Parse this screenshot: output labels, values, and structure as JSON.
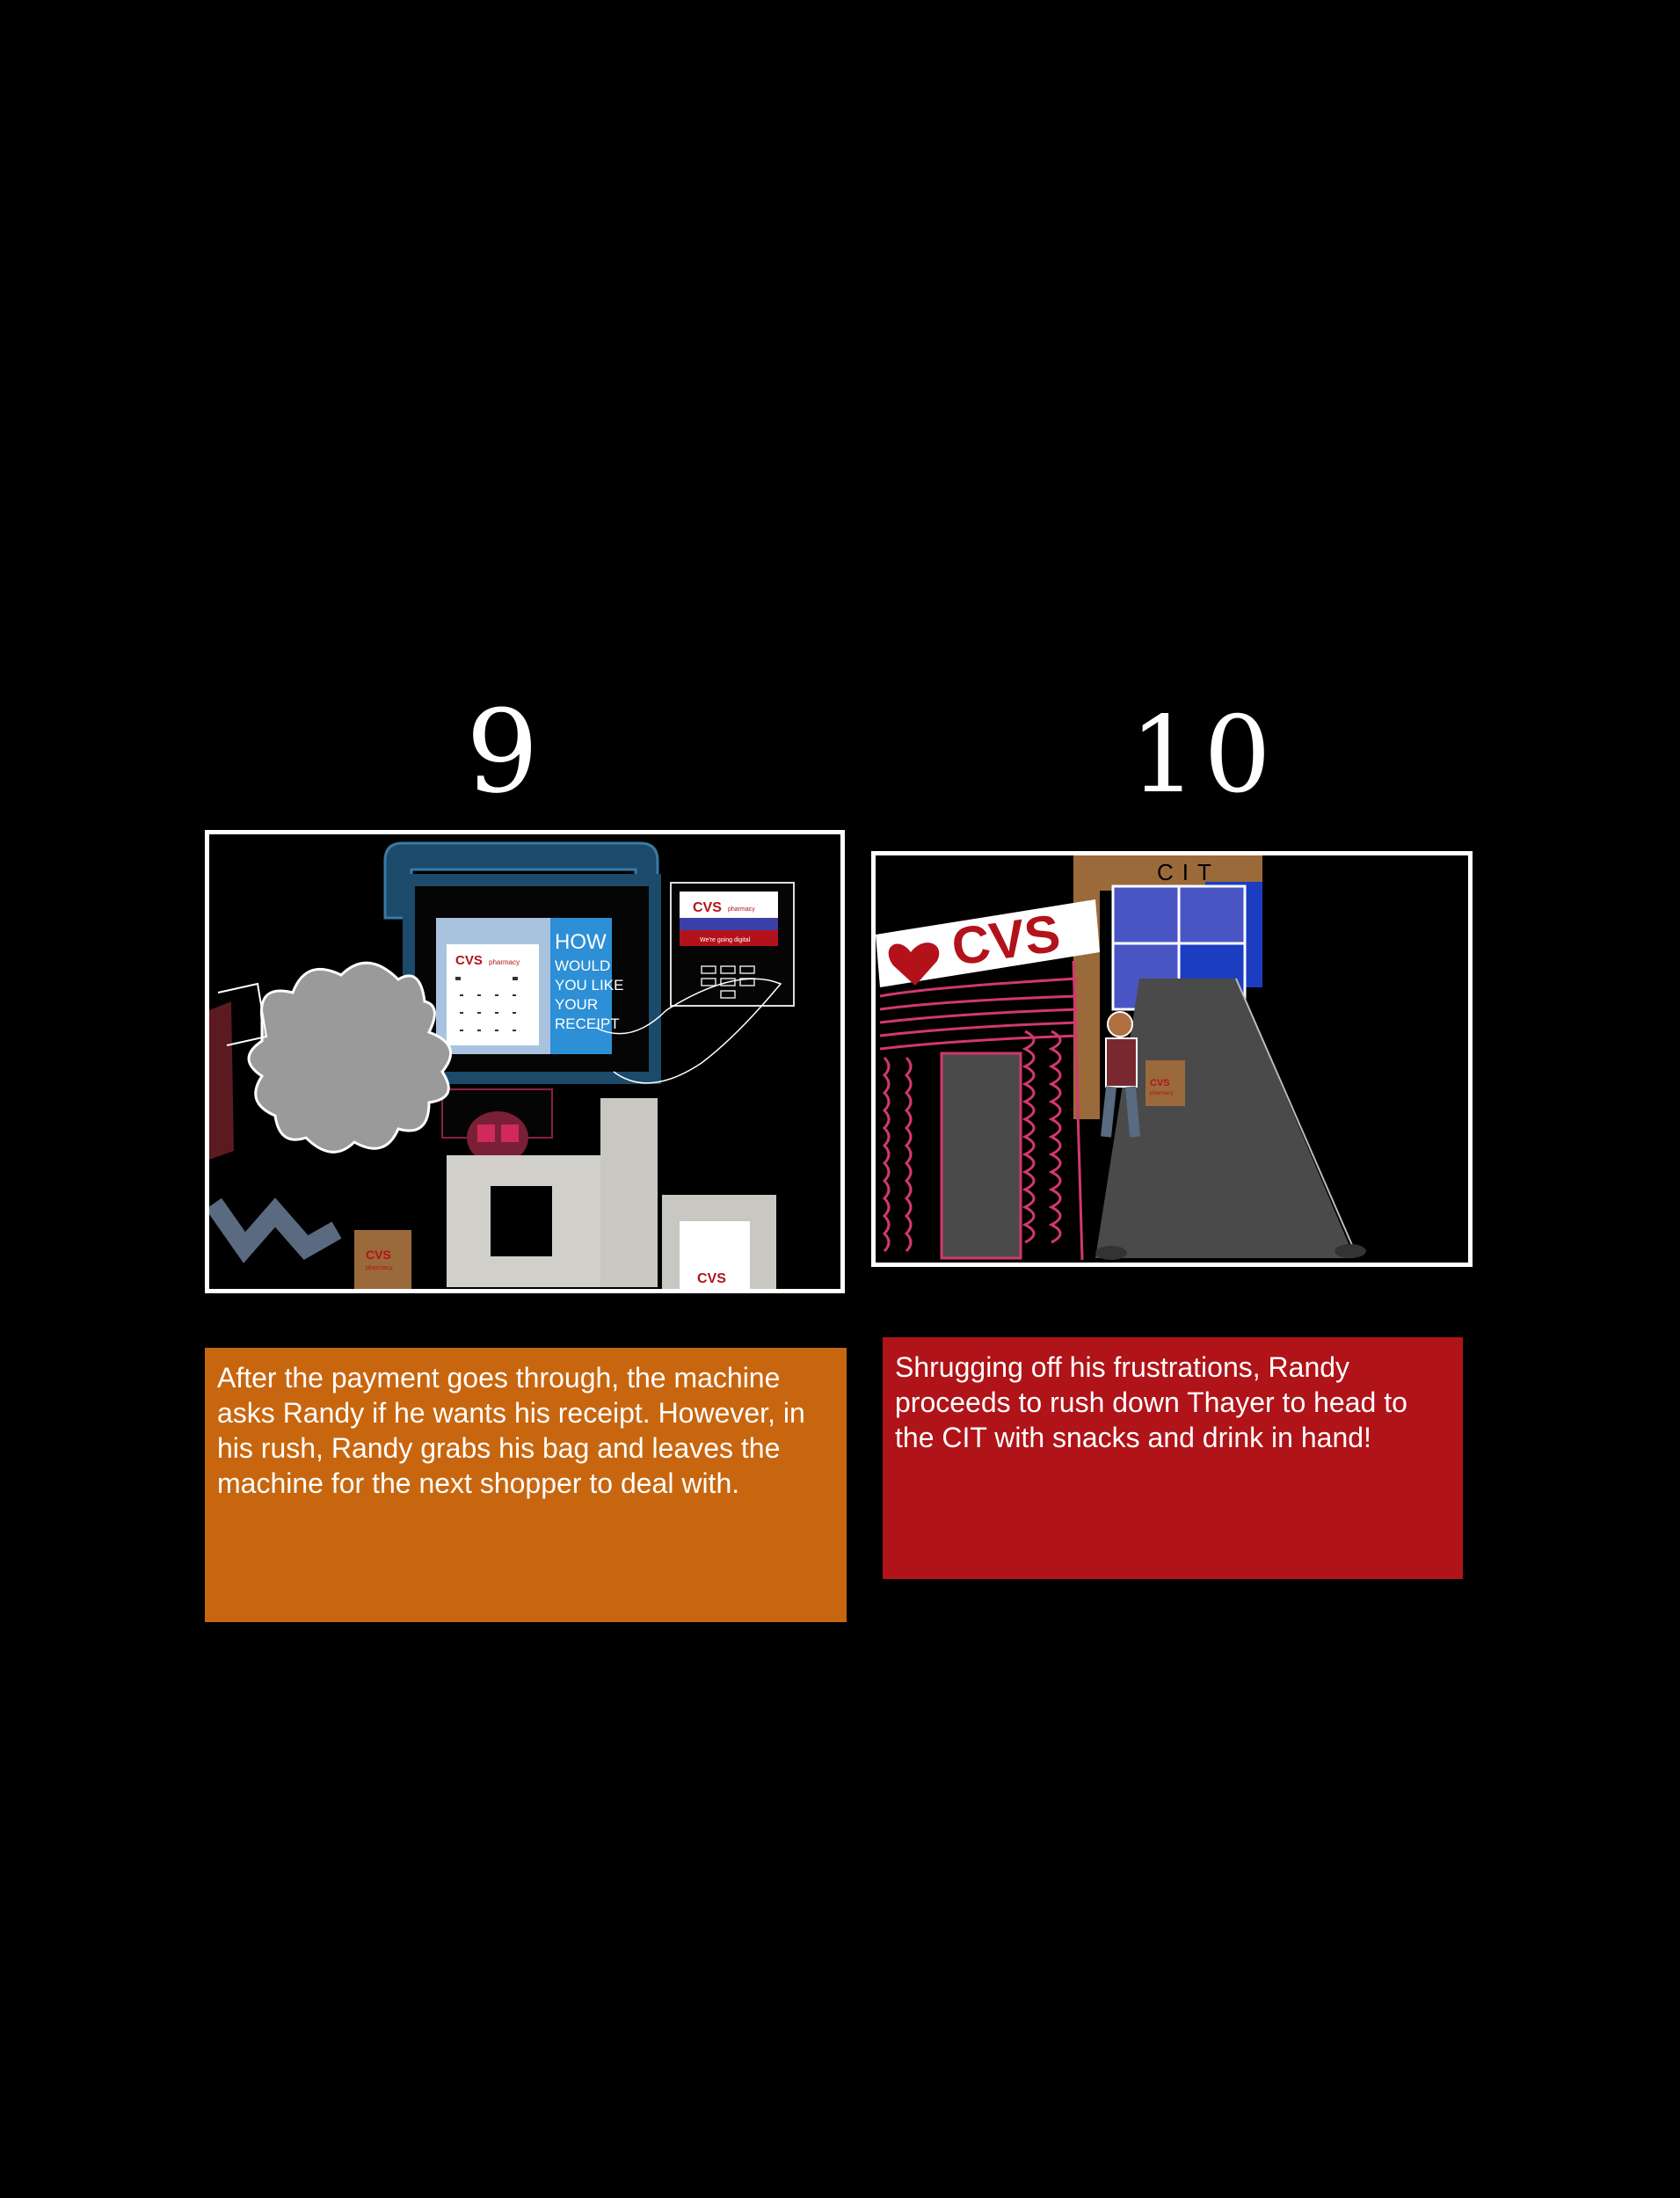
{
  "panels": [
    {
      "number": "9",
      "screen": {
        "brand": "CVS",
        "brand_sub": "pharmacy",
        "prompt_lines": [
          "HOW",
          "WOULD",
          "YOU LIKE",
          "YOUR",
          "RECEIPT"
        ]
      },
      "card_reader": {
        "brand": "CVS",
        "brand_sub": "pharmacy",
        "tagline": "We're going digital"
      },
      "bag": {
        "brand": "CVS",
        "brand_sub": "pharmacy"
      },
      "bin_label": "CVS",
      "caption": "After the payment goes through, the machine asks Randy if he wants his receipt. However, in his rush, Randy grabs his bag and leaves the machine for the next shopper to deal with."
    },
    {
      "number": "10",
      "store_sign": "CVS",
      "building_sign": "CIT",
      "bag": {
        "brand": "CVS",
        "brand_sub": "pharmacy"
      },
      "caption": "Shrugging off his frustrations, Randy proceeds to rush down Thayer to head to the CIT with snacks and drink in hand!"
    }
  ],
  "colors": {
    "caption9_bg": "#c8660f",
    "caption10_bg": "#b01318",
    "cvs_red": "#b3121b",
    "machine_blue": "#1b4a6b",
    "pink_scribble": "#d2386e",
    "window_blue": "#4a55c4"
  }
}
